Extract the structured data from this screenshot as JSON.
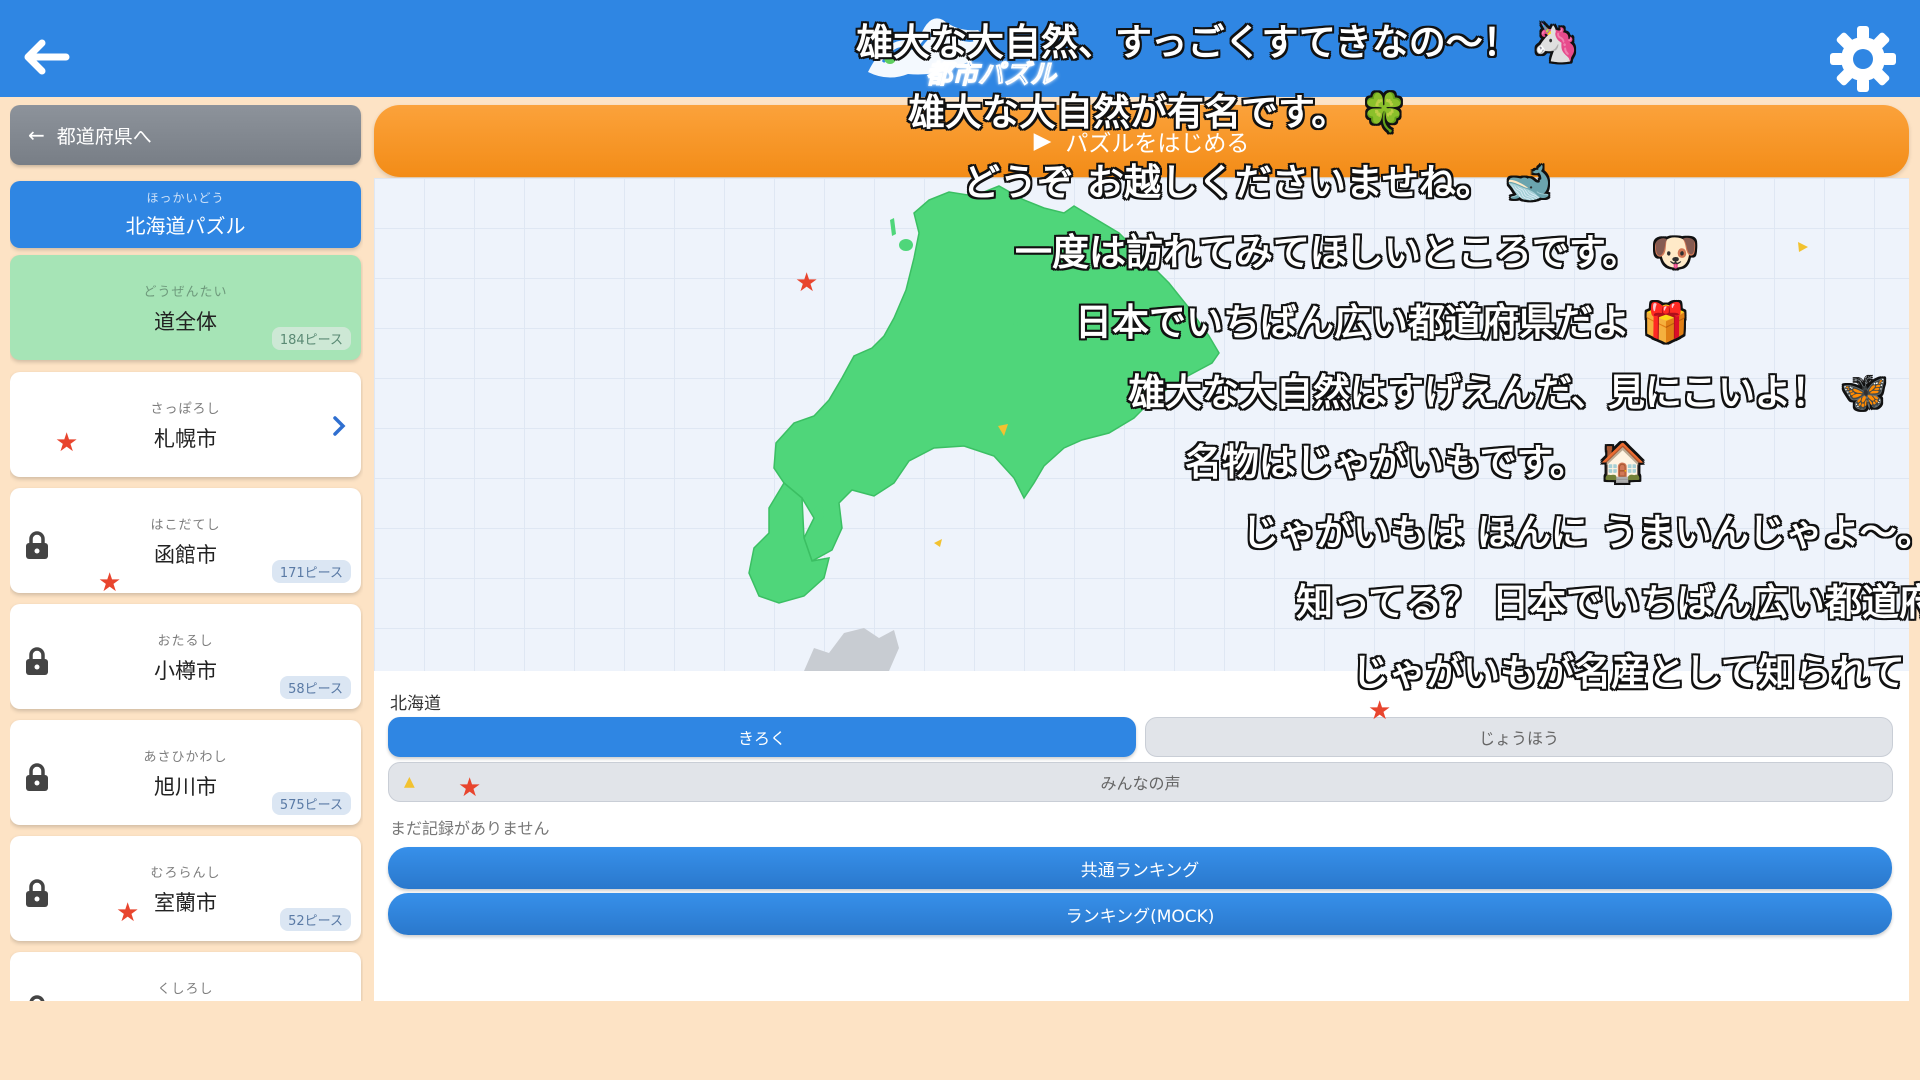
{
  "header": {
    "logo_text": "都市パズル",
    "icons": {
      "back": "back-arrow-icon",
      "settings": "gear-icon"
    }
  },
  "sidebar": {
    "back_label": "都道府県へ",
    "selected": {
      "kana": "ほっかいどう",
      "name": "北海道パズル"
    },
    "whole": {
      "kana": "どうぜんたい",
      "name": "道全体",
      "pieces": "184ピース"
    },
    "cities": [
      {
        "kana": "さっぽろし",
        "name": "札幌市",
        "pieces": "",
        "locked": false
      },
      {
        "kana": "はこだてし",
        "name": "函館市",
        "pieces": "171ピース",
        "locked": true
      },
      {
        "kana": "おたるし",
        "name": "小樽市",
        "pieces": "58ピース",
        "locked": true
      },
      {
        "kana": "あさひかわし",
        "name": "旭川市",
        "pieces": "575ピース",
        "locked": true
      },
      {
        "kana": "むろらんし",
        "name": "室蘭市",
        "pieces": "52ピース",
        "locked": true
      },
      {
        "kana": "くしろし",
        "name": "",
        "pieces": "",
        "locked": true
      }
    ]
  },
  "main": {
    "start_label": "パズルをはじめる",
    "region_label": "北海道",
    "tabs": [
      "きろく",
      "じょうほう",
      "みんなの声"
    ],
    "no_record": "まだ記録がありません",
    "ranking_common": "共通ランキング",
    "ranking_mock": "ランキング(MOCK)"
  },
  "comments": [
    "雄大な大自然、すっごくすてきなの〜！ 🦄",
    "雄大な大自然が有名です。 🍀",
    "どうぞ お越しくださいませね。 🐋",
    "一度は訪れてみてほしいところです。 🐶",
    "日本でいちばん広い都道府県だよ 🎁",
    "雄大な大自然はすげえんだ、見にこいよ！ 🦋",
    "名物はじゃがいもです。 🏠",
    "じゃがいもは ほんに うまいんじゃよ〜。",
    "知ってる？ 日本でいちばん広い都道府",
    "じゃがいもが名産として知られて"
  ],
  "colors": {
    "header": "#2f86e3",
    "start": "#f7941d",
    "map_land": "#4fd67a",
    "background": "#fde3c5"
  }
}
